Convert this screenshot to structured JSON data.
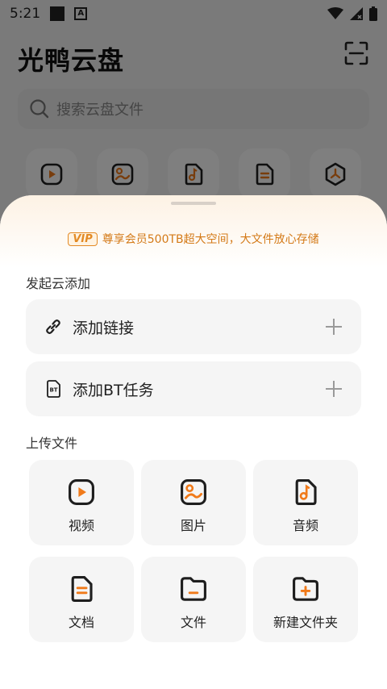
{
  "status_bar": {
    "time": "5:21",
    "a_icon": "A"
  },
  "app": {
    "title": "光鸭云盘"
  },
  "search": {
    "placeholder": "搜索云盘文件"
  },
  "categories": [
    {
      "icon": "video-icon"
    },
    {
      "icon": "image-icon"
    },
    {
      "icon": "music-icon"
    },
    {
      "icon": "document-icon"
    },
    {
      "icon": "more-icon"
    }
  ],
  "sheet": {
    "vip": {
      "badge": "VIP",
      "text": "尊享会员500TB超大空间，大文件放心存储"
    },
    "cloud_add": {
      "heading": "发起云添加",
      "add_link": "添加链接",
      "add_bt": "添加BT任务",
      "bt_icon_text": "BT"
    },
    "upload": {
      "heading": "上传文件",
      "tiles": [
        {
          "label": "视频",
          "icon": "video-icon"
        },
        {
          "label": "图片",
          "icon": "image-icon"
        },
        {
          "label": "音频",
          "icon": "music-icon"
        },
        {
          "label": "文档",
          "icon": "document-icon"
        },
        {
          "label": "文件",
          "icon": "folder-icon"
        },
        {
          "label": "新建文件夹",
          "icon": "new-folder-icon"
        }
      ]
    }
  },
  "colors": {
    "accent": "#f07a1a",
    "icon_dark": "#1e1e1e",
    "vip": "#d47a18"
  }
}
